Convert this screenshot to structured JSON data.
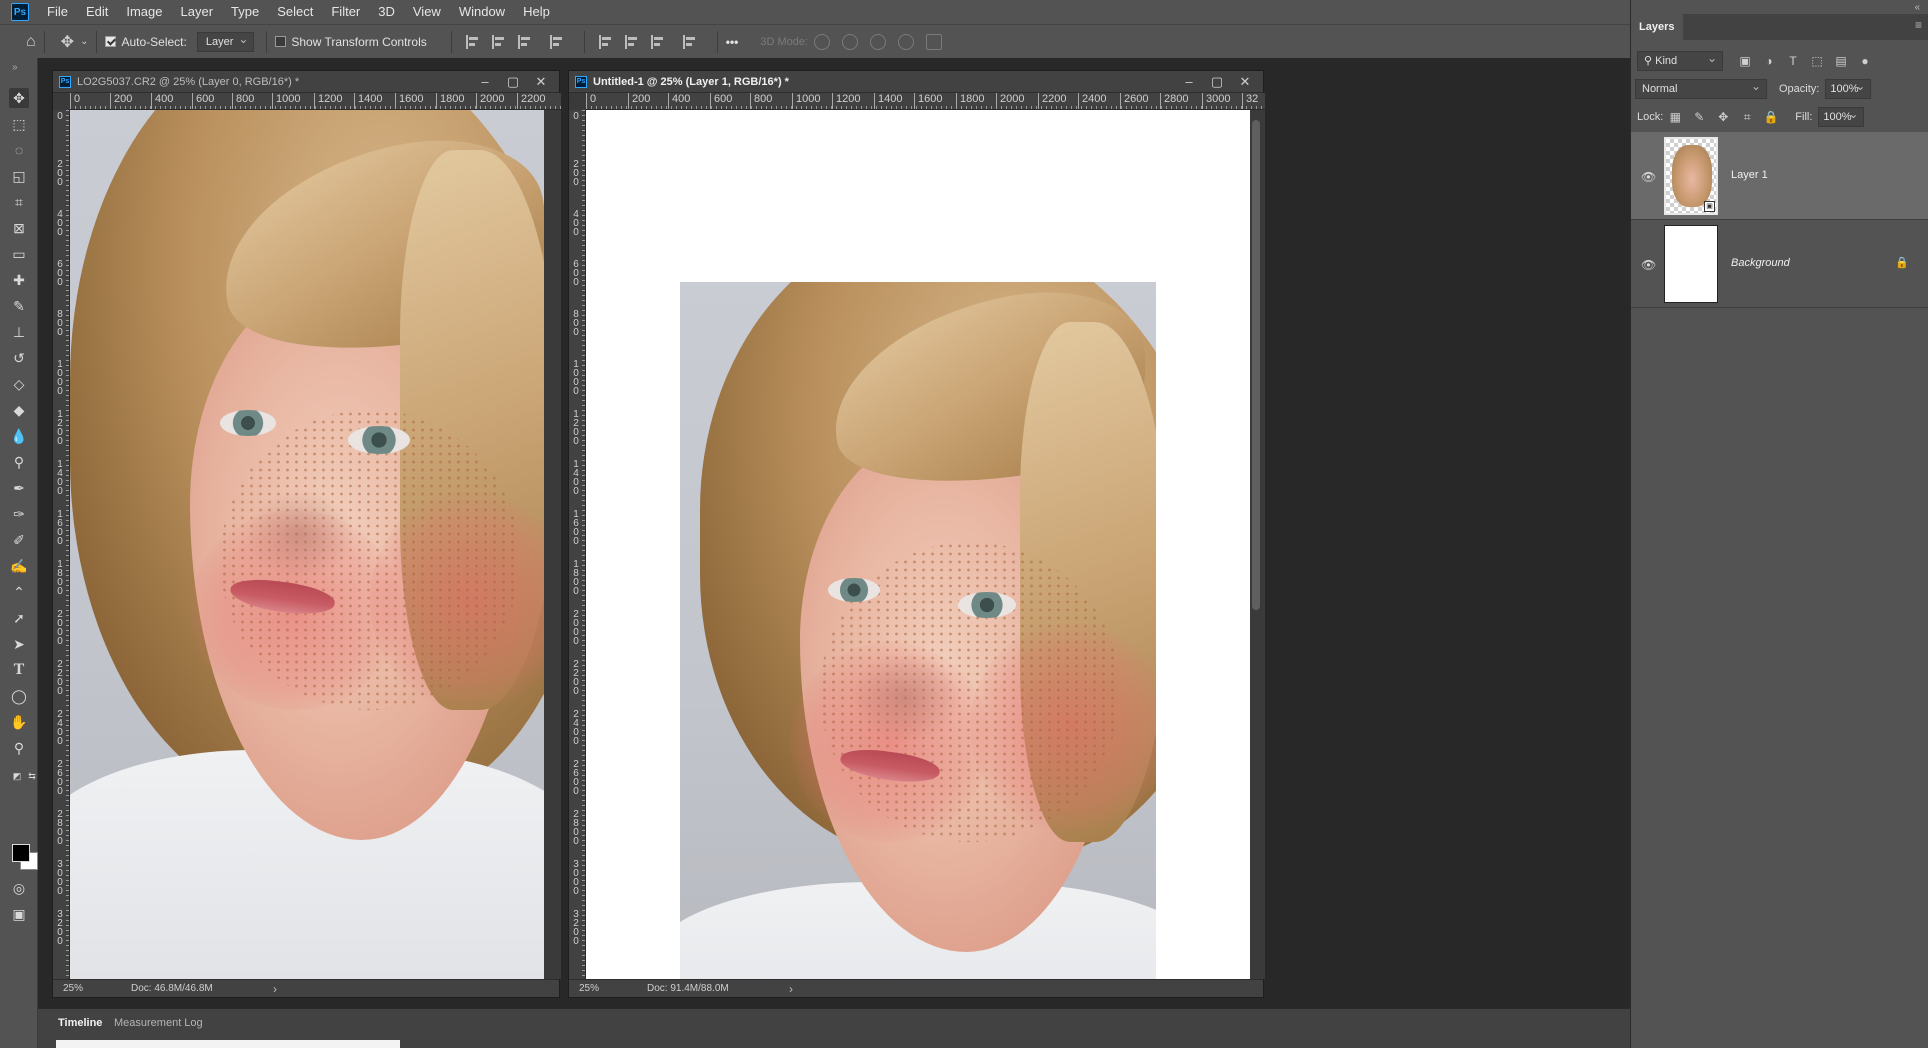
{
  "menu": {
    "logo": "Ps",
    "items": [
      "File",
      "Edit",
      "Image",
      "Layer",
      "Type",
      "Select",
      "Filter",
      "3D",
      "View",
      "Window",
      "Help"
    ]
  },
  "options_bar": {
    "auto_select_label": "Auto-Select:",
    "auto_select_checked": true,
    "auto_select_target": "Layer",
    "show_transform_label": "Show Transform Controls",
    "show_transform_checked": false,
    "mode_3d_label": "3D Mode:",
    "more_label": "•••"
  },
  "documents": [
    {
      "title": "LO2G5037.CR2 @ 25% (Layer 0, RGB/16*) *",
      "zoom": "25%",
      "doc_info": "Doc: 46.8M/46.8M",
      "ruler_h": [
        "0",
        "200",
        "400",
        "600",
        "800",
        "1000",
        "1200",
        "1400",
        "1600",
        "1800",
        "2000",
        "2200"
      ],
      "ruler_v": [
        "0",
        "200",
        "400",
        "600",
        "800",
        "1000",
        "1200",
        "1400",
        "1600",
        "1800",
        "2000",
        "2200",
        "2400",
        "2600",
        "2800",
        "3000",
        "3200",
        "3400"
      ],
      "active": false
    },
    {
      "title": "Untitled-1 @ 25% (Layer 1, RGB/16*) *",
      "zoom": "25%",
      "doc_info": "Doc: 91.4M/88.0M",
      "ruler_h": [
        "0",
        "200",
        "400",
        "600",
        "800",
        "1000",
        "1200",
        "1400",
        "1600",
        "1800",
        "2000",
        "2200",
        "2400",
        "2600",
        "2800",
        "3000",
        "32"
      ],
      "ruler_v": [
        "0",
        "200",
        "400",
        "600",
        "800",
        "1000",
        "1200",
        "1400",
        "1600",
        "1800",
        "2000",
        "2200",
        "2400",
        "2600",
        "2800",
        "3000",
        "3200",
        "3400"
      ],
      "active": true
    }
  ],
  "bottom_panel": {
    "tabs": [
      "Timeline",
      "Measurement Log"
    ]
  },
  "layers_panel": {
    "tab_label": "Layers",
    "filter_kind": "Kind",
    "blend_mode": "Normal",
    "opacity_label": "Opacity:",
    "opacity_value": "100%",
    "lock_label": "Lock:",
    "fill_label": "Fill:",
    "fill_value": "100%",
    "layers": [
      {
        "name": "Layer 1",
        "visible": true,
        "selected": true,
        "locked": false
      },
      {
        "name": "Background",
        "visible": true,
        "selected": false,
        "locked": true
      }
    ]
  },
  "icons": {
    "move": "move-tool-icon",
    "home": "home-icon",
    "eye": "eye-icon",
    "lock": "lock-icon"
  }
}
